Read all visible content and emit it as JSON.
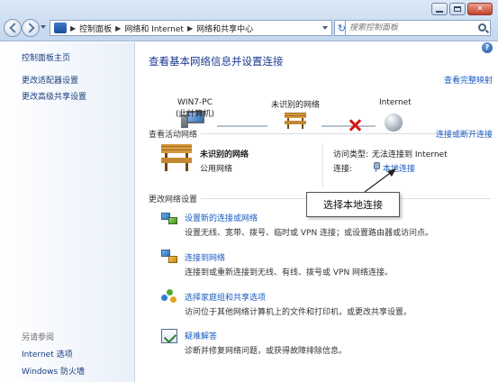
{
  "window": {
    "breadcrumb": [
      "控制面板",
      "网络和 Internet",
      "网络和共享中心"
    ],
    "search_placeholder": "搜索控制面板"
  },
  "sidebar": {
    "items": [
      {
        "label": "控制面板主页"
      },
      {
        "label": "更改适配器设置"
      },
      {
        "label": "更改高级共享设置"
      }
    ],
    "see_also_label": "另请参阅",
    "see_also": [
      {
        "label": "Internet 选项"
      },
      {
        "label": "Windows 防火墙"
      }
    ]
  },
  "main": {
    "title": "查看基本网络信息并设置连接",
    "full_map_link": "查看完整映射",
    "network_map": [
      {
        "label": "WIN7-PC",
        "sublabel": "(此计算机)"
      },
      {
        "label": "未识别的网络"
      },
      {
        "label": "Internet"
      }
    ],
    "active_networks_label": "查看活动网络",
    "connect_disconnect_link": "连接或断开连接",
    "network": {
      "name": "未识别的网络",
      "type": "公用网络",
      "access_type_label": "访问类型:",
      "access_type_value": "无法连接到 Internet",
      "connections_label": "连接:",
      "connection_link": "本地连接"
    },
    "change_settings_label": "更改网络设置",
    "tasks": [
      {
        "link": "设置新的连接或网络",
        "desc": "设置无线、宽带、拨号、临时或 VPN 连接；或设置路由器或访问点。",
        "icon": "network-setup-icon"
      },
      {
        "link": "连接到网络",
        "desc": "连接到或重新连接到无线、有线、拨号或 VPN 网络连接。",
        "icon": "connect-network-icon"
      },
      {
        "link": "选择家庭组和共享选项",
        "desc": "访问位于其他网络计算机上的文件和打印机，或更改共享设置。",
        "icon": "homegroup-icon"
      },
      {
        "link": "疑难解答",
        "desc": "诊断并修复网络问题，或获得故障排除信息。",
        "icon": "troubleshoot-icon"
      }
    ]
  },
  "callout": {
    "text": "选择本地连接"
  },
  "colors": {
    "link": "#1a5bc2",
    "title": "#1c3a90",
    "error_x": "#d11818"
  }
}
